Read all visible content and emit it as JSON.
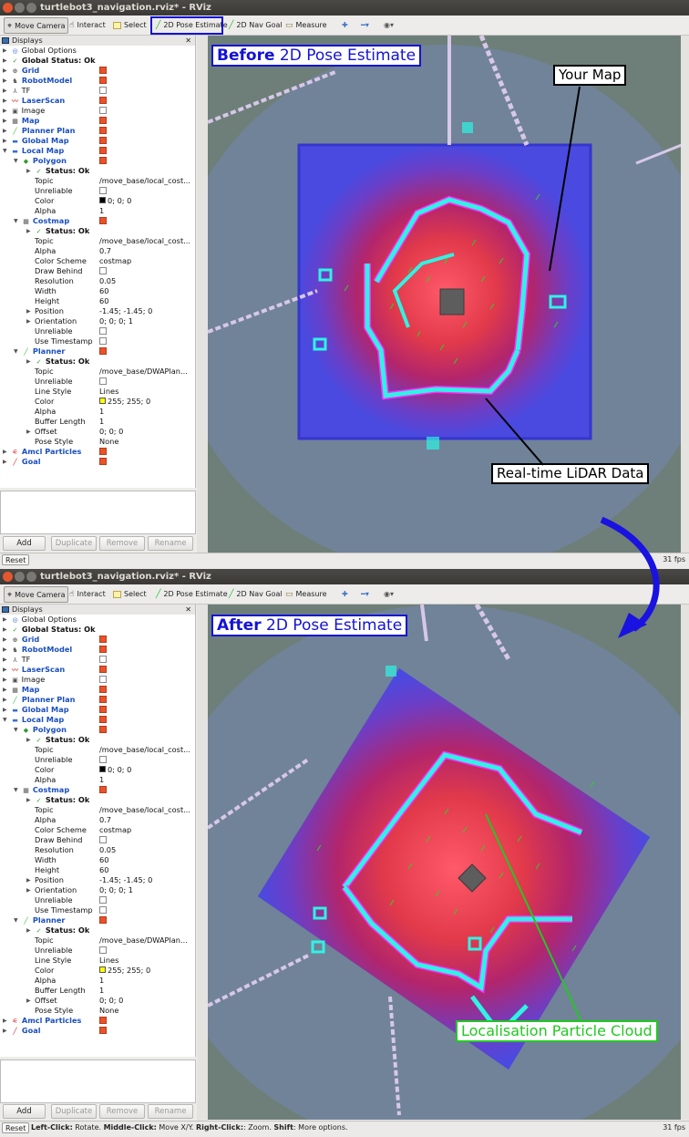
{
  "window": {
    "title": "turtlebot3_navigation.rviz* - RViz"
  },
  "toolbar": {
    "move_camera": "Move Camera",
    "interact": "Interact",
    "select": "Select",
    "pose_estimate": "2D Pose Estimate",
    "nav_goal": "2D Nav Goal",
    "measure": "Measure"
  },
  "displays": {
    "header": "Displays",
    "rows": [
      {
        "label": "Global Options",
        "value": ""
      },
      {
        "label": "Global Status: Ok",
        "value": ""
      },
      {
        "label": "Grid",
        "value": ""
      },
      {
        "label": "RobotModel",
        "value": ""
      },
      {
        "label": "TF",
        "value": ""
      },
      {
        "label": "LaserScan",
        "value": ""
      },
      {
        "label": "Image",
        "value": ""
      },
      {
        "label": "Map",
        "value": ""
      },
      {
        "label": "Planner Plan",
        "value": ""
      },
      {
        "label": "Global Map",
        "value": ""
      },
      {
        "label": "Local Map",
        "value": ""
      },
      {
        "label": "Polygon",
        "value": ""
      },
      {
        "label": "Status: Ok",
        "value": ""
      },
      {
        "label": "Topic",
        "value": "/move_base/local_cost..."
      },
      {
        "label": "Unreliable",
        "value": ""
      },
      {
        "label": "Color",
        "value": "0; 0; 0"
      },
      {
        "label": "Alpha",
        "value": "1"
      },
      {
        "label": "Costmap",
        "value": ""
      },
      {
        "label": "Status: Ok",
        "value": ""
      },
      {
        "label": "Topic",
        "value": "/move_base/local_cost..."
      },
      {
        "label": "Alpha",
        "value": "0.7"
      },
      {
        "label": "Color Scheme",
        "value": "costmap"
      },
      {
        "label": "Draw Behind",
        "value": ""
      },
      {
        "label": "Resolution",
        "value": "0.05"
      },
      {
        "label": "Width",
        "value": "60"
      },
      {
        "label": "Height",
        "value": "60"
      },
      {
        "label": "Position",
        "value": "-1.45; -1.45; 0"
      },
      {
        "label": "Orientation",
        "value": "0; 0; 0; 1"
      },
      {
        "label": "Unreliable",
        "value": ""
      },
      {
        "label": "Use Timestamp",
        "value": ""
      },
      {
        "label": "Planner",
        "value": ""
      },
      {
        "label": "Status: Ok",
        "value": ""
      },
      {
        "label": "Topic",
        "value": "/move_base/DWAPlan..."
      },
      {
        "label": "Unreliable",
        "value": ""
      },
      {
        "label": "Line Style",
        "value": "Lines"
      },
      {
        "label": "Color",
        "value": "255; 255; 0"
      },
      {
        "label": "Alpha",
        "value": "1"
      },
      {
        "label": "Buffer Length",
        "value": "1"
      },
      {
        "label": "Offset",
        "value": "0; 0; 0"
      },
      {
        "label": "Pose Style",
        "value": "None"
      },
      {
        "label": "Amcl Particles",
        "value": ""
      },
      {
        "label": "Goal",
        "value": ""
      }
    ]
  },
  "panel_buttons": {
    "add": "Add",
    "duplicate": "Duplicate",
    "remove": "Remove",
    "rename": "Rename"
  },
  "reset": "Reset",
  "fps": "31 fps",
  "status_bar": {
    "left_click": "Left-Click:",
    "left_click_desc": " Rotate. ",
    "middle_click": "Middle-Click:",
    "middle_click_desc": " Move X/Y. ",
    "right_click": "Right-Click:",
    "right_click_desc": ": Zoom. ",
    "shift": "Shift",
    "shift_desc": ": More options."
  },
  "annotations": {
    "before_bold": "Before",
    "before_rest": " 2D Pose Estimate",
    "after_bold": "After",
    "after_rest": " 2D Pose Estimate",
    "your_map": "Your Map",
    "lidar": "Real-time LiDAR Data",
    "particles": "Localisation Particle Cloud"
  },
  "colors": {
    "costmap_blue": "#3b3bd8",
    "costmap_red": "#e0202a",
    "wall_cyan": "#2ff3e4",
    "wall_magenta": "#e22de8",
    "particle_green": "#2bd12b",
    "annot_blue": "#1412d6",
    "annot_green": "#22c822"
  }
}
